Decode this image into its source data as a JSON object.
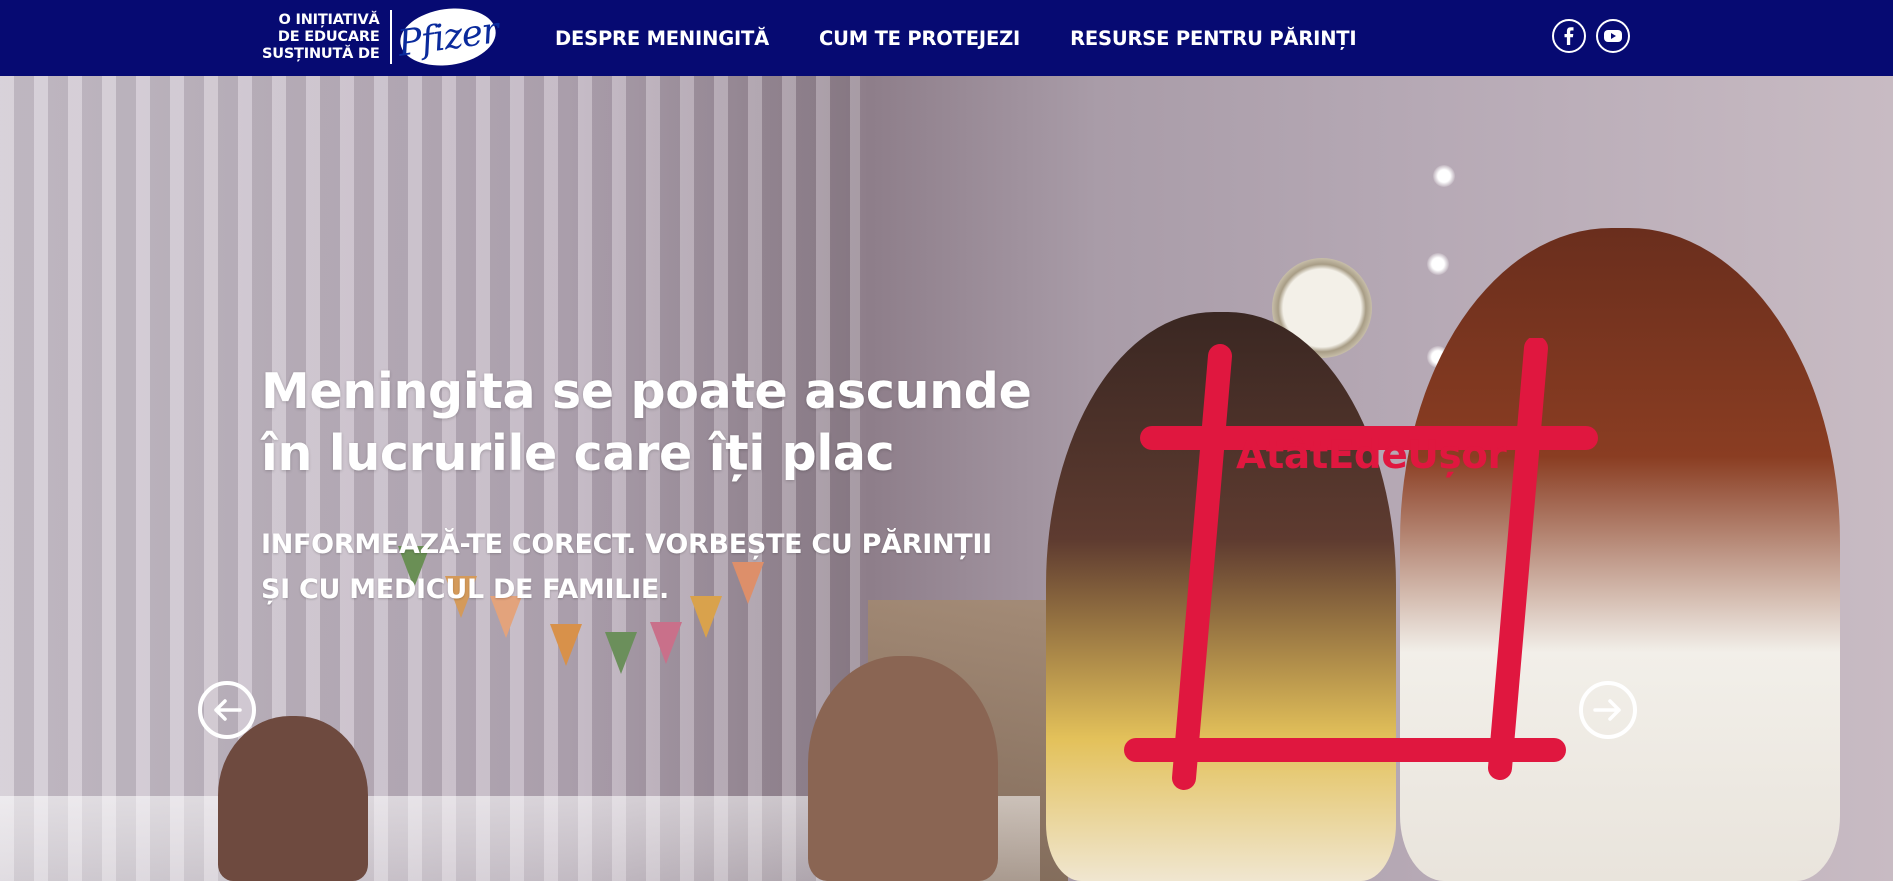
{
  "colors": {
    "nav_bg": "#060a72",
    "accent": "#e0173f",
    "text_light": "#ffffff"
  },
  "brand": {
    "tagline_lines": [
      "O INIȚIATIVĂ",
      "DE EDUCARE",
      "SUSȚINUTĂ DE"
    ],
    "logo_text": "Pfizer"
  },
  "nav": {
    "items": [
      {
        "label": "DESPRE MENINGITĂ"
      },
      {
        "label": "CUM TE PROTEJEZI"
      },
      {
        "label": "RESURSE PENTRU PĂRINȚI"
      }
    ]
  },
  "social": {
    "icons": [
      "facebook-icon",
      "youtube-icon"
    ]
  },
  "hero": {
    "title_lines": [
      "Meningita se poate ascunde",
      "în lucrurile care îți plac"
    ],
    "subtitle_lines": [
      "INFORMEAZĂ-TE CORECT. VORBEȘTE CU PĂRINȚII",
      "ȘI CU MEDICUL DE FAMILIE."
    ],
    "hashtag": "AtâtEdeUșor"
  },
  "carousel": {
    "prev_icon": "arrow-left-icon",
    "next_icon": "arrow-right-icon"
  }
}
